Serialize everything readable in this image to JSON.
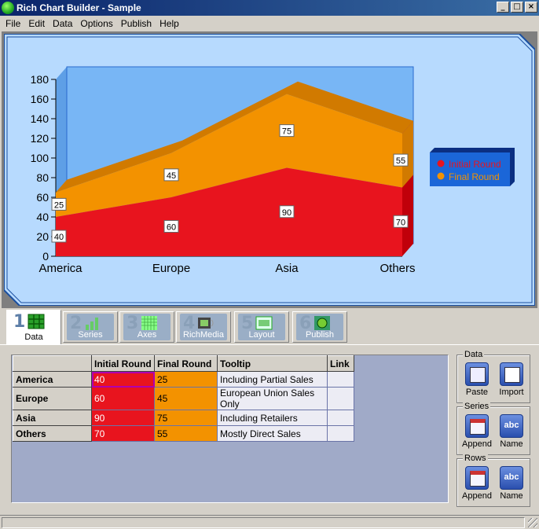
{
  "window": {
    "title": "Rich Chart Builder - Sample"
  },
  "menu": [
    "File",
    "Edit",
    "Data",
    "Options",
    "Publish",
    "Help"
  ],
  "chart_data": {
    "type": "area",
    "categories": [
      "America",
      "Europe",
      "Asia",
      "Others"
    ],
    "series": [
      {
        "name": "Initial Round",
        "values": [
          40,
          60,
          90,
          70
        ],
        "color": "#e8141e"
      },
      {
        "name": "Final Round",
        "values": [
          25,
          45,
          75,
          55
        ],
        "color": "#f39200"
      }
    ],
    "stacked": true,
    "ylim": [
      0,
      180
    ],
    "yticks": [
      0,
      20,
      40,
      60,
      80,
      100,
      120,
      140,
      160,
      180
    ],
    "legend_position": "right",
    "background": "#b7dafe",
    "plot_background": "#78b6f5"
  },
  "tabs": [
    {
      "num": "1",
      "label": "Data",
      "active": true
    },
    {
      "num": "2",
      "label": "Series"
    },
    {
      "num": "3",
      "label": "Axes"
    },
    {
      "num": "4",
      "label": "RichMedia"
    },
    {
      "num": "5",
      "label": "Layout"
    },
    {
      "num": "6",
      "label": "Publish"
    }
  ],
  "grid": {
    "headers": [
      "",
      "Initial Round",
      "Final Round",
      "Tooltip",
      "Link"
    ],
    "rows": [
      {
        "name": "America",
        "initial": "40",
        "final": "25",
        "tooltip": "Including Partial Sales",
        "link": ""
      },
      {
        "name": "Europe",
        "initial": "60",
        "final": "45",
        "tooltip": "European Union Sales Only",
        "link": ""
      },
      {
        "name": "Asia",
        "initial": "90",
        "final": "75",
        "tooltip": "Including Retailers",
        "link": ""
      },
      {
        "name": "Others",
        "initial": "70",
        "final": "55",
        "tooltip": "Mostly Direct Sales",
        "link": ""
      }
    ]
  },
  "side": {
    "data": {
      "title": "Data",
      "paste": "Paste",
      "import": "Import"
    },
    "series": {
      "title": "Series",
      "append": "Append",
      "name": "Name"
    },
    "rows": {
      "title": "Rows",
      "append": "Append",
      "name": "Name"
    },
    "abc": "abc"
  }
}
